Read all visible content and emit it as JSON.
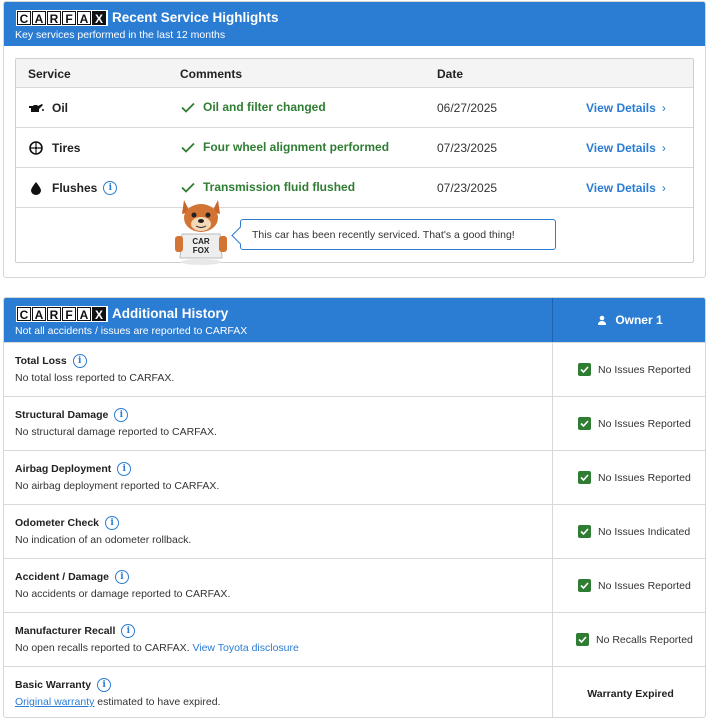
{
  "service_panel": {
    "logo_letters": [
      "C",
      "A",
      "R",
      "F",
      "A",
      "X"
    ],
    "title": "Recent Service Highlights",
    "subtitle": "Key services performed in the last 12 months",
    "headers": {
      "service": "Service",
      "comments": "Comments",
      "date": "Date"
    },
    "rows": [
      {
        "service": "Oil",
        "icon": "oil-can-icon",
        "comment": "Oil and filter changed",
        "date": "06/27/2025",
        "link": "View Details"
      },
      {
        "service": "Tires",
        "icon": "tire-icon",
        "comment": "Four wheel alignment performed",
        "date": "07/23/2025",
        "link": "View Details"
      },
      {
        "service": "Flushes",
        "icon": "drop-icon",
        "comment": "Transmission fluid flushed",
        "date": "07/23/2025",
        "link": "View Details"
      }
    ],
    "fox_shirt_line1": "CAR",
    "fox_shirt_line2": "FOX",
    "bubble_text": "This car has been recently serviced. That's a good thing!"
  },
  "history_panel": {
    "logo_letters": [
      "C",
      "A",
      "R",
      "F",
      "A",
      "X"
    ],
    "title": "Additional History",
    "subtitle": "Not all accidents / issues are reported to CARFAX",
    "owner_label": "Owner 1",
    "rows": [
      {
        "title": "Total Loss",
        "desc": "No total loss reported to CARFAX.",
        "status": "No Issues Reported"
      },
      {
        "title": "Structural Damage",
        "desc": "No structural damage reported to CARFAX.",
        "status": "No Issues Reported"
      },
      {
        "title": "Airbag Deployment",
        "desc": "No airbag deployment reported to CARFAX.",
        "status": "No Issues Reported"
      },
      {
        "title": "Odometer Check",
        "desc": "No indication of an odometer rollback.",
        "status": "No Issues Indicated"
      },
      {
        "title": "Accident / Damage",
        "desc": "No accidents or damage reported to CARFAX.",
        "status": "No Issues Reported"
      },
      {
        "title": "Manufacturer Recall",
        "desc": "No open recalls reported to CARFAX.",
        "desc_link": "View Toyota disclosure",
        "status": "No Recalls Reported"
      },
      {
        "title": "Basic Warranty",
        "desc_link": "Original warranty",
        "desc": "estimated to have expired.",
        "status": "Warranty Expired"
      }
    ]
  },
  "colors": {
    "brand_blue": "#2b7cd3",
    "success_green": "#2f7d32"
  }
}
